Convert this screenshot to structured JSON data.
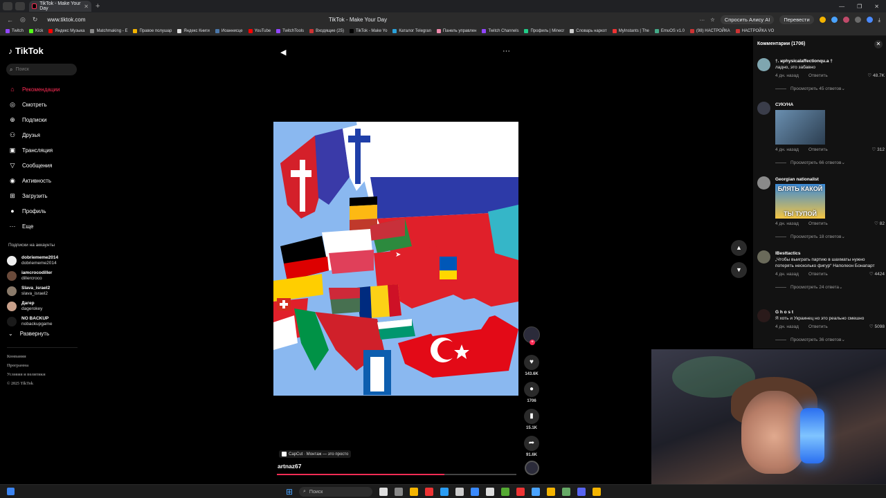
{
  "browser": {
    "tab_title": "TikTok - Make Your Day",
    "url": "www.tiktok.com",
    "page_title": "TikTok - Make Your Day",
    "ask_alice": "Спросить Алису AI",
    "translate": "Перевести",
    "bookmarks": [
      "Twitch",
      "Kick",
      "Яндекс Музыка",
      "Matchmaking - E",
      "Правое полушар",
      "Яндекс Книги",
      "Иоанниcце",
      "YouTube",
      "TwitchTools",
      "Входящие (25)",
      "TikTok - Make Yo",
      "Каталог Telegran",
      "Панель управлен",
      "Twitch Channels",
      "Профиль | Minecr",
      "Словарь наркот",
      "MyInstants | The",
      "EmuOS v1.0",
      "(98) НАСТРОЙКА",
      "НАСТРОЙКА VO"
    ]
  },
  "sidebar": {
    "logo": "TikTok",
    "search_placeholder": "Поиск",
    "menu": [
      {
        "label": "Рекомендации",
        "icon": "home-icon",
        "glyph": "⌂"
      },
      {
        "label": "Смотреть",
        "icon": "compass-icon",
        "glyph": "◎"
      },
      {
        "label": "Подписки",
        "icon": "following-icon",
        "glyph": "⊕"
      },
      {
        "label": "Друзья",
        "icon": "friends-icon",
        "glyph": "⚇"
      },
      {
        "label": "Трансляция",
        "icon": "live-icon",
        "glyph": "▣"
      },
      {
        "label": "Сообщения",
        "icon": "messages-icon",
        "glyph": "▽"
      },
      {
        "label": "Активность",
        "icon": "activity-icon",
        "glyph": "◉"
      },
      {
        "label": "Загрузить",
        "icon": "upload-icon",
        "glyph": "⊞"
      },
      {
        "label": "Профиль",
        "icon": "profile-icon",
        "glyph": "●"
      },
      {
        "label": "Еще",
        "icon": "more-icon",
        "glyph": "···"
      }
    ],
    "subs_title": "Подписки на аккаунты",
    "subscriptions": [
      {
        "name": "dobriememe2014",
        "handle": "dobriememe2014"
      },
      {
        "name": "iamcrocodiller",
        "handle": "dillercroco"
      },
      {
        "name": "Slava_israel2",
        "handle": "slava_israel2"
      },
      {
        "name": "Дагер",
        "handle": "dagerokey"
      },
      {
        "name": "NO BACKUP",
        "handle": "nobackupgame"
      }
    ],
    "expand": "Развернуть",
    "footer": [
      "Компания",
      "Программа",
      "Условия и политики",
      "© 2025 TikTok"
    ]
  },
  "video": {
    "author": "artnaz67",
    "capcut": "CapCut · Монтаж — это просто",
    "likes": "143.6K",
    "comments": "1706",
    "saves": "15.1K",
    "shares": "91.6K",
    "progress": 0.7
  },
  "comments_panel": {
    "title": "Комментарии (1706)",
    "items": [
      {
        "user": "†. ʁphysicalaffectionqu.a †",
        "text": "ладно, это забавно",
        "time": "4 дн. назад",
        "reply": "Ответить",
        "likes": "48.7K",
        "more": "Просмотреть 45 ответов"
      },
      {
        "user": "СУКУНА",
        "text": "",
        "time": "4 дн. назад",
        "reply": "Ответить",
        "likes": "312",
        "more": "Просмотреть 66 ответов"
      },
      {
        "user": "Georgian nationalist",
        "text": "",
        "sticker_top": "БЛЯТЬ КАКОЙ",
        "sticker_bottom": "ТЫ ТУПОЙ",
        "time": "4 дн. назад",
        "reply": "Ответить",
        "likes": "82",
        "more": "Просмотреть 18 ответов"
      },
      {
        "user": "lBesttactics",
        "text": "„Чтобы выиграть партию в шахматы нужно потерять несколько фигур“ Наполеон Бонапарт",
        "time": "4 дн. назад",
        "reply": "Ответить",
        "likes": "4424",
        "more": "Просмотреть 24 ответа"
      },
      {
        "user": "G h o s t",
        "text": "Я хоть и Украинец но это реально смешно",
        "time": "4 дн. назад",
        "reply": "Ответить",
        "likes": "5098",
        "more": "Просмотреть 36 ответов"
      }
    ]
  },
  "taskbar": {
    "search": "Поиск"
  }
}
